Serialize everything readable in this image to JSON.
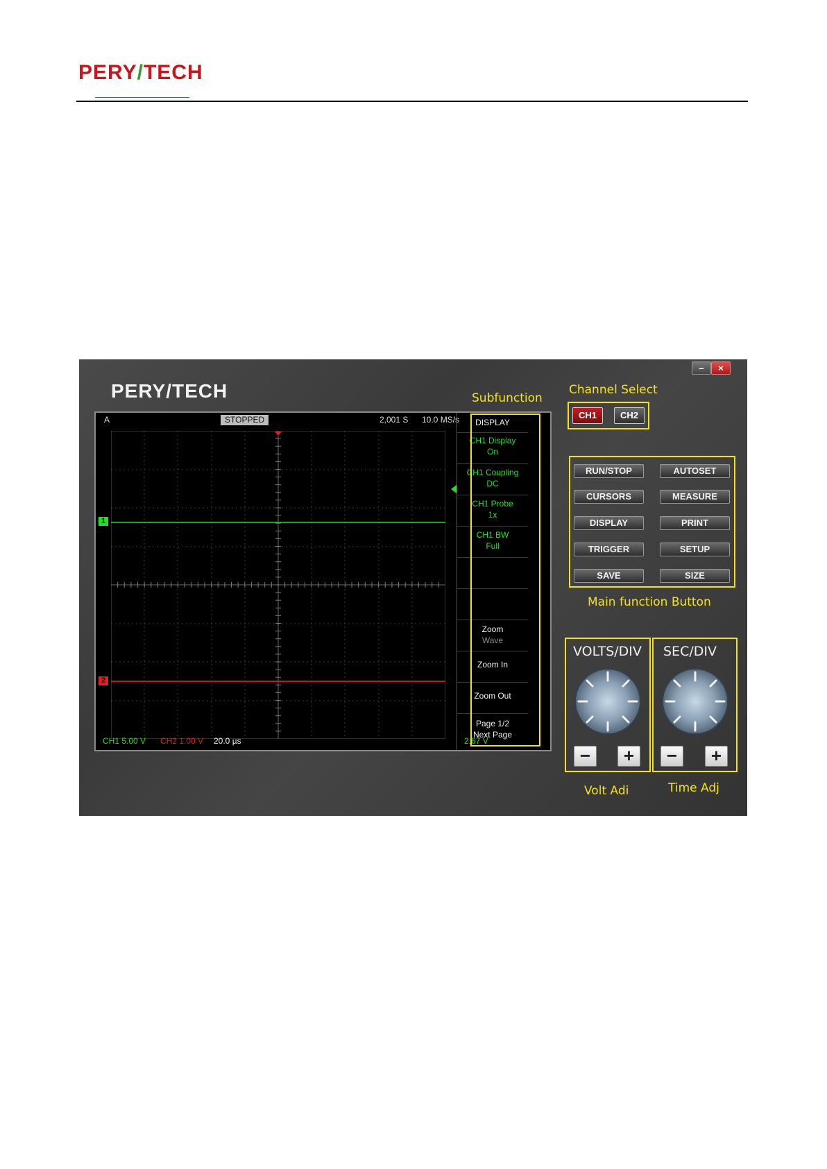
{
  "document": {
    "logo": {
      "left": "PERY",
      "slash": "/",
      "right": "TECH"
    }
  },
  "app": {
    "logo": {
      "left": "PERY",
      "slash": "/",
      "right": "TECH"
    },
    "window": {
      "minimize_label": "–",
      "close_label": "×"
    },
    "annotations": {
      "subfunction": "Subfunction",
      "channel_select": "Channel Select",
      "main_function": "Main function Button",
      "volt_adj": "Volt Adi",
      "time_adj": "Time Adj"
    },
    "screen": {
      "mode_label": "A",
      "status": "STOPPED",
      "samples": "2,001 S",
      "sample_rate": "10.0 MS/s",
      "ch1_marker": "1",
      "ch2_marker": "2",
      "ch1_scale": "CH1 5.00 V",
      "ch2_scale": "CH2 1.00 V",
      "timebase": "20.0 µs",
      "trigger_level": "2.67 V"
    },
    "subfunction_menu": {
      "title": "DISPLAY",
      "items": [
        {
          "line1": "CH1 Display",
          "line2": "On"
        },
        {
          "line1": "CH1 Coupling",
          "line2": "DC"
        },
        {
          "line1": "CH1 Probe",
          "line2": "1x"
        },
        {
          "line1": "CH1 BW",
          "line2": "Full"
        },
        {
          "line1": "",
          "line2": ""
        },
        {
          "line1": "",
          "line2": ""
        },
        {
          "line1": "Zoom",
          "line2": "Wave"
        },
        {
          "line1": "Zoom In",
          "line2": ""
        },
        {
          "line1": "Zoom Out",
          "line2": ""
        },
        {
          "line1": "Page 1/2",
          "line2": "Next Page"
        }
      ]
    },
    "channels": {
      "ch1": "CH1",
      "ch2": "CH2"
    },
    "main_buttons": [
      "RUN/STOP",
      "AUTOSET",
      "CURSORS",
      "MEASURE",
      "DISPLAY",
      "PRINT",
      "TRIGGER",
      "SETUP",
      "SAVE",
      "SIZE"
    ],
    "knobs": {
      "volts": {
        "label": "VOLTS/DIV",
        "minus": "−",
        "plus": "+"
      },
      "sec": {
        "label": "SEC/DIV",
        "minus": "−",
        "plus": "+"
      }
    },
    "colors": {
      "ch1": "#22e022",
      "ch2": "#e02020",
      "annotation": "#f5e21d",
      "logo_red": "#c8161d",
      "logo_green": "#3a9a2a"
    }
  }
}
